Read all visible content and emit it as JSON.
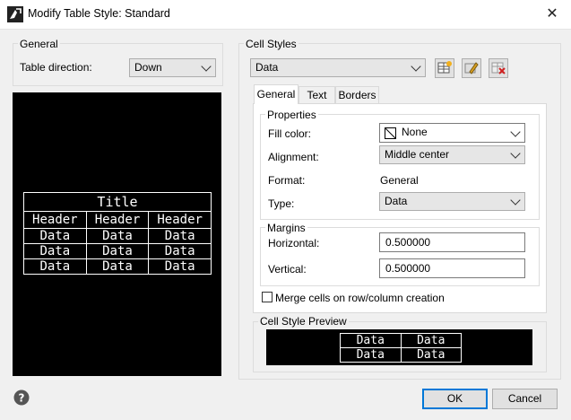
{
  "window": {
    "title": "Modify Table Style: Standard"
  },
  "general_group": {
    "label": "General",
    "table_direction_label": "Table direction:",
    "table_direction_value": "Down"
  },
  "preview_table": {
    "title": "Title",
    "headers": [
      "Header",
      "Header",
      "Header"
    ],
    "rows": [
      [
        "Data",
        "Data",
        "Data"
      ],
      [
        "Data",
        "Data",
        "Data"
      ],
      [
        "Data",
        "Data",
        "Data"
      ]
    ]
  },
  "cell_styles": {
    "label": "Cell Styles",
    "selected": "Data",
    "tabs": [
      {
        "label": "General",
        "active": true
      },
      {
        "label": "Text",
        "active": false
      },
      {
        "label": "Borders",
        "active": false
      }
    ],
    "properties": {
      "label": "Properties",
      "fill_color_label": "Fill color:",
      "fill_color_value": "None",
      "alignment_label": "Alignment:",
      "alignment_value": "Middle center",
      "format_label": "Format:",
      "format_value": "General",
      "type_label": "Type:",
      "type_value": "Data"
    },
    "margins": {
      "label": "Margins",
      "horizontal_label": "Horizontal:",
      "horizontal_value": "0.500000",
      "vertical_label": "Vertical:",
      "vertical_value": "0.500000"
    },
    "merge_label": "Merge cells on row/column creation",
    "preview": {
      "label": "Cell Style Preview",
      "rows": [
        [
          "Data",
          "Data"
        ],
        [
          "Data",
          "Data"
        ]
      ]
    }
  },
  "buttons": {
    "ok": "OK",
    "cancel": "Cancel"
  }
}
